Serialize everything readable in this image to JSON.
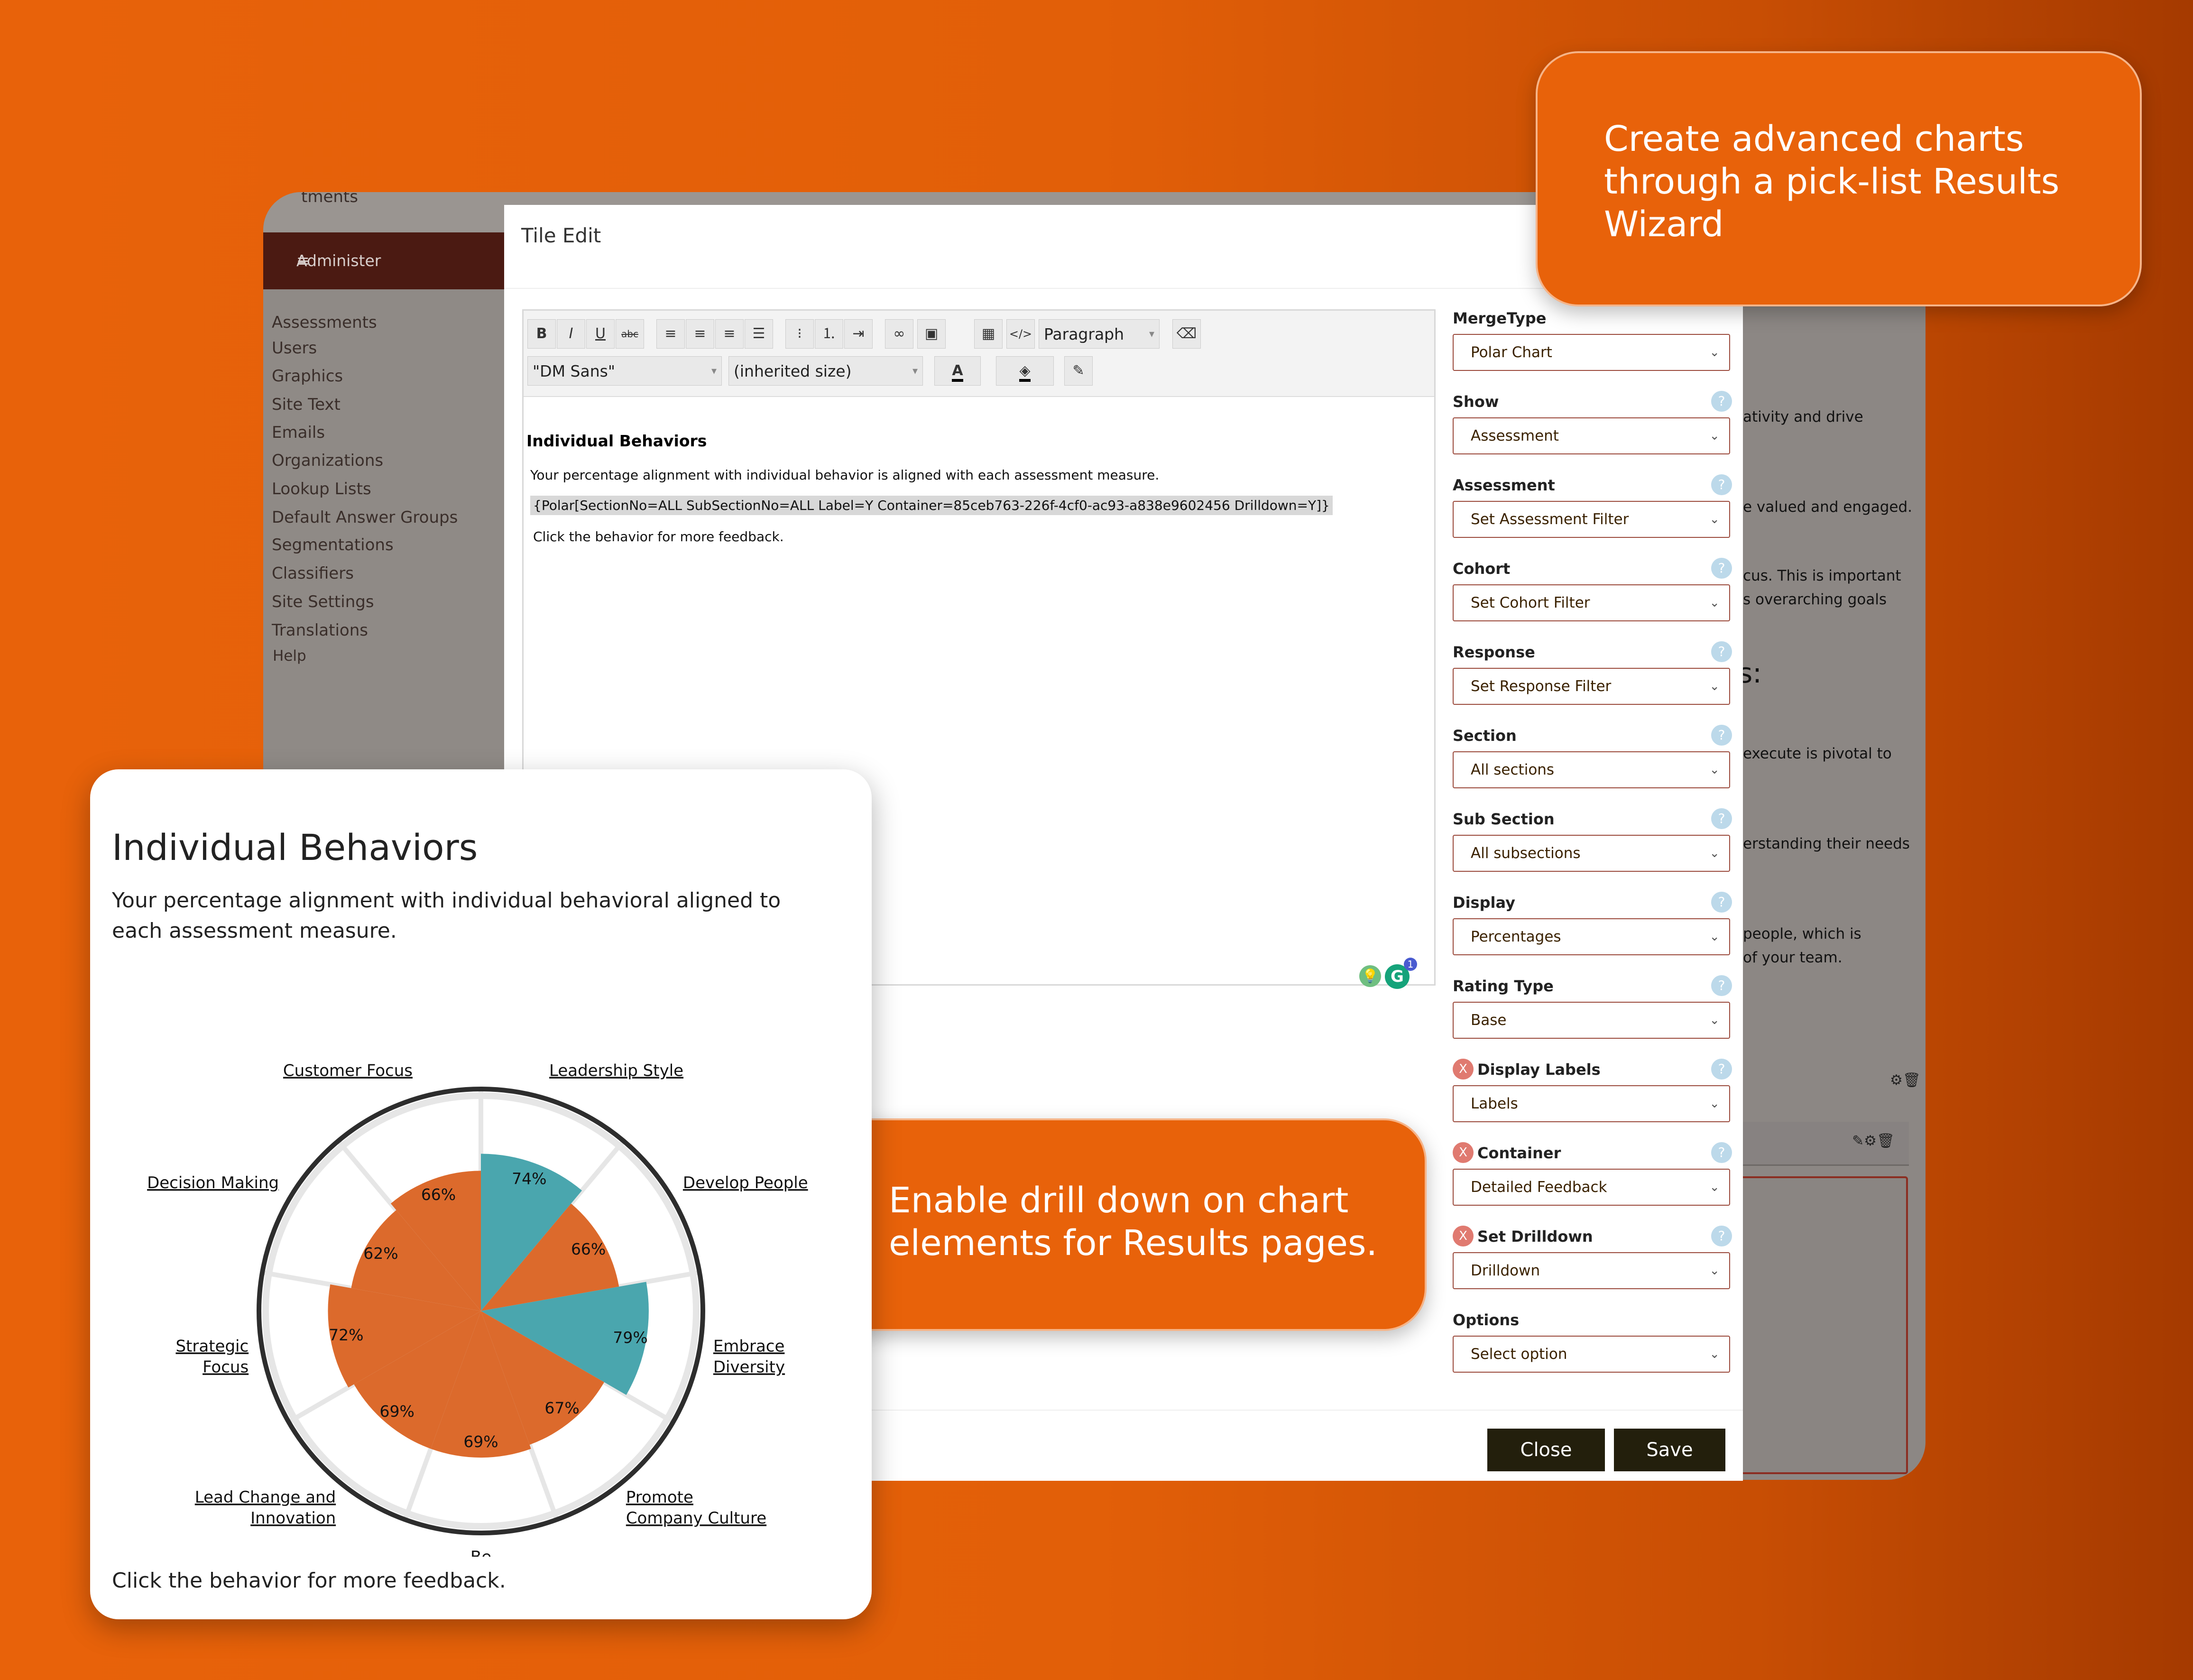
{
  "callouts": {
    "top": [
      "Create advanced charts",
      "through a pick-list Results",
      "Wizard"
    ],
    "middle": [
      "Enable drill down on chart",
      "elements for Results pages."
    ]
  },
  "background_app": {
    "truncated_top": "tments",
    "admin_label": "Administer",
    "menu": [
      "Assessments",
      "Users",
      "Graphics",
      "Site Text",
      "Emails",
      "Organizations",
      "Lookup Lists",
      "Default Answer Groups",
      "Segmentations",
      "Classifiers",
      "Site Settings",
      "Translations",
      "Help"
    ],
    "right_snippets": [
      "ativity and drive",
      "e valued and engaged.",
      "cus. This is important",
      "s overarching goals",
      "s:",
      "execute is pivotal to",
      "erstanding their needs",
      "people, which is",
      "of your team."
    ]
  },
  "modal": {
    "title": "Tile Edit",
    "toolbar": {
      "bold": "B",
      "italic": "I",
      "underline": "U",
      "strike": "abc",
      "block_format": "Paragraph",
      "font_family": "\"DM Sans\"",
      "font_size": "(inherited size)",
      "text_color": "A"
    },
    "content": {
      "heading": "Individual Behaviors",
      "para1": "Your percentage alignment with individual behavior is aligned with each assessment measure.",
      "merge_code": "{Polar[SectionNo=ALL SubSectionNo=ALL Label=Y Container=85ceb763-226f-4cf0-ac93-a838e9602456 Drilldown=Y]}",
      "para2": "Click the behavior for more feedback."
    },
    "form": [
      {
        "label": "MergeType",
        "value": "Polar Chart",
        "help": false,
        "removable": false
      },
      {
        "label": "Show",
        "value": "Assessment",
        "help": true,
        "removable": false
      },
      {
        "label": "Assessment",
        "value": "Set Assessment Filter",
        "help": true,
        "removable": false
      },
      {
        "label": "Cohort",
        "value": "Set Cohort Filter",
        "help": true,
        "removable": false
      },
      {
        "label": "Response",
        "value": "Set Response Filter",
        "help": true,
        "removable": false
      },
      {
        "label": "Section",
        "value": "All sections",
        "help": true,
        "removable": false
      },
      {
        "label": "Sub Section",
        "value": "All subsections",
        "help": true,
        "removable": false
      },
      {
        "label": "Display",
        "value": "Percentages",
        "help": true,
        "removable": false
      },
      {
        "label": "Rating Type",
        "value": "Base",
        "help": true,
        "removable": false
      },
      {
        "label": "Display Labels",
        "value": "Labels",
        "help": true,
        "removable": true
      },
      {
        "label": "Container",
        "value": "Detailed Feedback",
        "help": true,
        "removable": true
      },
      {
        "label": "Set Drilldown",
        "value": "Drilldown",
        "help": true,
        "removable": true
      },
      {
        "label": "Options",
        "value": "Select option",
        "help": false,
        "removable": false
      }
    ],
    "close_label": "Close",
    "save_label": "Save",
    "help_glyph": "?",
    "remove_glyph": "X",
    "grammarly_badge": "1"
  },
  "card": {
    "title": "Individual Behaviors",
    "subtitle": "Your percentage alignment with individual behavioral aligned to each assessment measure.",
    "footer": "Click the behavior for more feedback."
  },
  "chart_data": {
    "type": "polar",
    "categories": [
      "Leadership Style",
      "Develop People",
      "Embrace Diversity",
      "Promote Company Culture",
      "Be Entrepreneurial",
      "Lead Change and Innovation",
      "Strategic Focus",
      "Decision Making",
      "Customer Focus"
    ],
    "values": [
      74,
      66,
      79,
      67,
      69,
      69,
      72,
      62,
      66
    ],
    "value_labels": [
      "74%",
      "66%",
      "79%",
      "67%",
      "69%",
      "69%",
      "72%",
      "62%",
      "66%"
    ],
    "highlight": [
      true,
      false,
      true,
      false,
      false,
      false,
      false,
      false,
      false
    ],
    "colors": {
      "default": "#dc6a2c",
      "highlight": "#4aa6ae",
      "ring": "#2d2d2d",
      "grid": "#e6e6e6"
    },
    "rmax": 100,
    "grid": true
  },
  "colors": {
    "accent": "#e8620a",
    "dark_button": "#231f0c"
  }
}
